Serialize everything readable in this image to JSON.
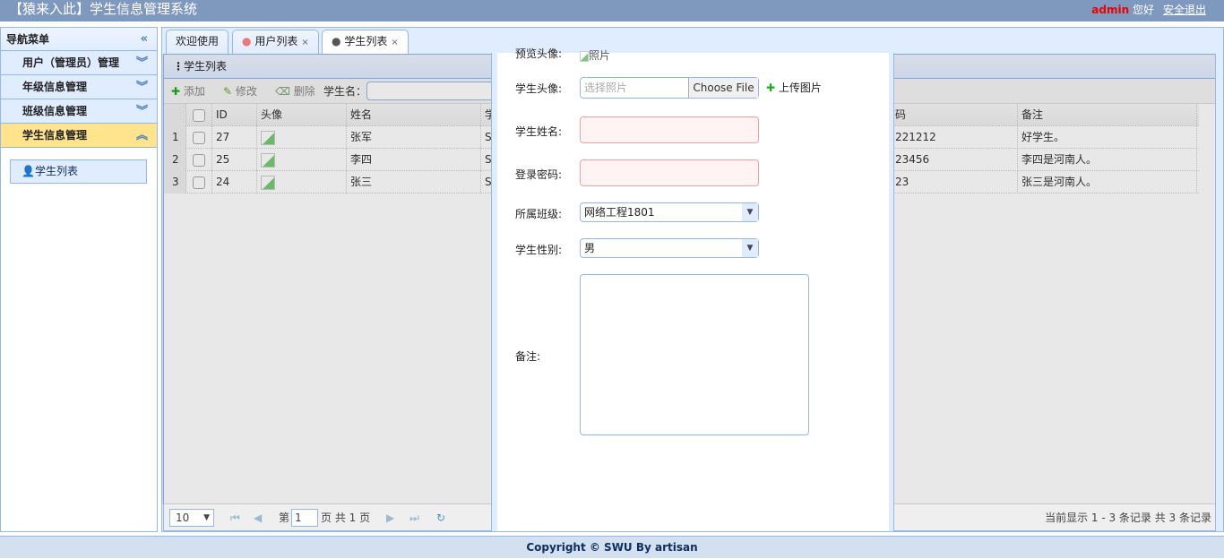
{
  "header": {
    "title": "【猿来入此】学生信息管理系统",
    "username": "admin",
    "greeting": "您好",
    "logout": "安全退出"
  },
  "sidebar": {
    "title": "导航菜单",
    "items": [
      {
        "label": "用户（管理员）管理"
      },
      {
        "label": "年级信息管理"
      },
      {
        "label": "班级信息管理"
      },
      {
        "label": "学生信息管理",
        "expanded": true
      }
    ],
    "sub_items": [
      {
        "label": "学生列表"
      }
    ]
  },
  "tabs": [
    {
      "label": "欢迎使用"
    },
    {
      "label": "用户列表"
    },
    {
      "label": "学生列表",
      "active": true
    }
  ],
  "panel": {
    "title": "学生列表"
  },
  "toolbar": {
    "add": "添加",
    "edit": "修改",
    "delete": "删除",
    "search_label": "学生名："
  },
  "grid": {
    "columns": [
      "ID",
      "头像",
      "姓名",
      "学",
      "码",
      "备注"
    ],
    "rows": [
      {
        "n": "1",
        "id": "27",
        "name": "张军",
        "sn": "S",
        "pwd": "221212",
        "remark": "好学生。"
      },
      {
        "n": "2",
        "id": "25",
        "name": "李四",
        "sn": "S",
        "pwd": "23456",
        "remark": "李四是河南人。"
      },
      {
        "n": "3",
        "id": "24",
        "name": "张三",
        "sn": "S",
        "pwd": "23",
        "remark": "张三是河南人。"
      }
    ]
  },
  "pager": {
    "page_size": "10",
    "page_prefix": "第",
    "page": "1",
    "page_suffix": "页 共 1 页",
    "summary": "当前显示 1 - 3 条记录 共 3 条记录"
  },
  "dialog": {
    "preview_label": "预览头像:",
    "preview_alt": "照片",
    "avatar_label": "学生头像:",
    "avatar_placeholder": "选择照片",
    "choose_file": "Choose File",
    "upload": "上传图片",
    "name_label": "学生姓名:",
    "password_label": "登录密码:",
    "class_label": "所属班级:",
    "class_value": "网络工程1801",
    "gender_label": "学生性别:",
    "gender_value": "男",
    "remark_label": "备注:"
  },
  "footer": {
    "text": "Copyright © SWU By artisan"
  },
  "colors": {
    "header": "#7f99be",
    "accent": "#95b8e7",
    "selected": "#ffe48d"
  }
}
